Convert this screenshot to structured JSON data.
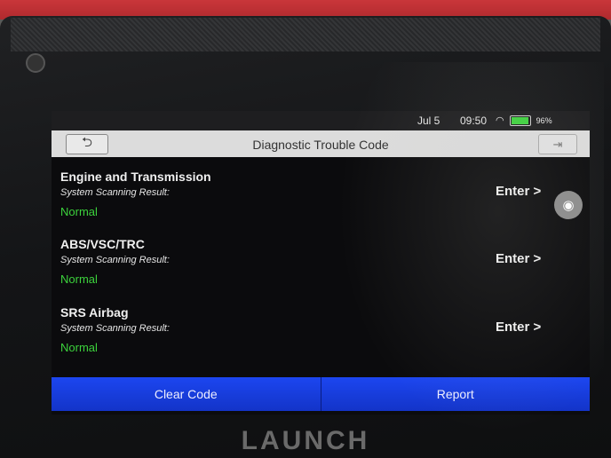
{
  "status_bar": {
    "date": "Jul 5",
    "time": "09:50",
    "battery": "96%",
    "battery_level": 0.96
  },
  "header": {
    "title": "Diagnostic Trouble Code",
    "back_icon": "back-arrow-icon",
    "exit_icon": "exit-icon"
  },
  "systems": [
    {
      "name": "Engine and Transmission",
      "subtitle": "System Scanning Result:",
      "status": "Normal",
      "enter_label": "Enter >"
    },
    {
      "name": "ABS/VSC/TRC",
      "subtitle": "System Scanning Result:",
      "status": "Normal",
      "enter_label": "Enter >"
    },
    {
      "name": "SRS Airbag",
      "subtitle": "System Scanning Result:",
      "status": "Normal",
      "enter_label": "Enter >"
    }
  ],
  "footer": {
    "clear_code": "Clear Code",
    "report": "Report"
  },
  "device": {
    "brand": "LAUNCH"
  },
  "colors": {
    "status_normal": "#3cd23c",
    "button_blue": "#1c46f0",
    "device_red": "#c9363a"
  }
}
